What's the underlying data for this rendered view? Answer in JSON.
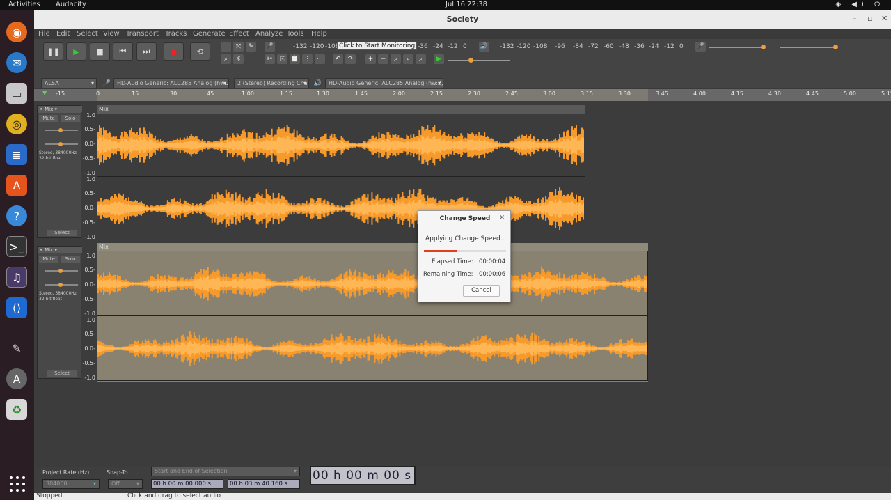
{
  "topbar": {
    "activities": "Activities",
    "app": "Audacity",
    "clock": "Jul 16  22:38",
    "tray": "◈ ◀) ⏻"
  },
  "window": {
    "title": "Society",
    "minimize": "–",
    "maximize": "▫",
    "close": "✕"
  },
  "menu": [
    "File",
    "Edit",
    "Select",
    "View",
    "Transport",
    "Tracks",
    "Generate",
    "Effect",
    "Analyze",
    "Tools",
    "Help"
  ],
  "transport": {
    "pause": "❚❚",
    "play": "▶",
    "stop": "■",
    "skip_start": "⏮",
    "skip_end": "⏭",
    "record": "●",
    "loop": "⟲"
  },
  "recording_meter": {
    "ticks": [
      "-132",
      "-120",
      "-108"
    ],
    "monitor_label": "Click to Start Monitoring",
    "ticks2": [
      "-36",
      "-24",
      "-12",
      "0"
    ]
  },
  "playback_meter": {
    "ticks": [
      "-132",
      "-120",
      "-108",
      "-96",
      "-84",
      "-72",
      "-60",
      "-48",
      "-36",
      "-24",
      "-12",
      "0"
    ]
  },
  "devices": {
    "host": "ALSA",
    "recording_device": "HD-Audio Generic: ALC285 Analog (hw:2,",
    "channels": "2 (Stereo) Recording Cha",
    "playback_device": "HD-Audio Generic: ALC285 Analog (hw:2,"
  },
  "ruler": {
    "ticks": [
      "-15",
      "0",
      "15",
      "30",
      "45",
      "1:00",
      "1:15",
      "1:30",
      "1:45",
      "2:00",
      "2:15",
      "2:30",
      "2:45",
      "3:00",
      "3:15",
      "3:30",
      "3:45",
      "4:00",
      "4:15",
      "4:30",
      "4:45",
      "5:00",
      "5:15"
    ]
  },
  "tracks": [
    {
      "name": "Mix",
      "clip_name": "Mix",
      "mute": "Mute",
      "solo": "Solo",
      "info1": "Stereo, 384000Hz",
      "info2": "32-bit float",
      "select": "Select",
      "scale": [
        "1.0",
        "0.5-",
        "0.0-",
        "-0.5-",
        "-1.0"
      ]
    },
    {
      "name": "Mix",
      "clip_name": "Mix",
      "mute": "Mute",
      "solo": "Solo",
      "info1": "Stereo, 384000Hz",
      "info2": "32-bit float",
      "select": "Select",
      "scale": [
        "1.0",
        "0.5-",
        "0.0-",
        "-0.5-",
        "-1.0"
      ]
    }
  ],
  "dialog": {
    "title": "Change Speed",
    "close": "✕",
    "message": "Applying Change Speed...",
    "progress": 0.4,
    "elapsed_label": "Elapsed Time:",
    "elapsed_value": "00:00:04",
    "remaining_label": "Remaining Time:",
    "remaining_value": "00:00:06",
    "cancel": "Cancel"
  },
  "selection_toolbar": {
    "project_rate_label": "Project Rate (Hz)",
    "project_rate_value": "384000",
    "snap_label": "Snap-To",
    "snap_value": "Off",
    "selection_mode": "Start and End of Selection",
    "start_time": "00 h 00 m 00.000 s",
    "end_time": "00 h 03 m 40.160 s",
    "audio_position": "00 h 00 m 00 s"
  },
  "status": {
    "state": "Stopped.",
    "hint": "Click and drag to select audio"
  },
  "colors": {
    "waveform": "#f79a2c",
    "waveform_light": "#ffb655",
    "selected_bg": "#8a8270",
    "track_bg": "#3c3c3c"
  }
}
